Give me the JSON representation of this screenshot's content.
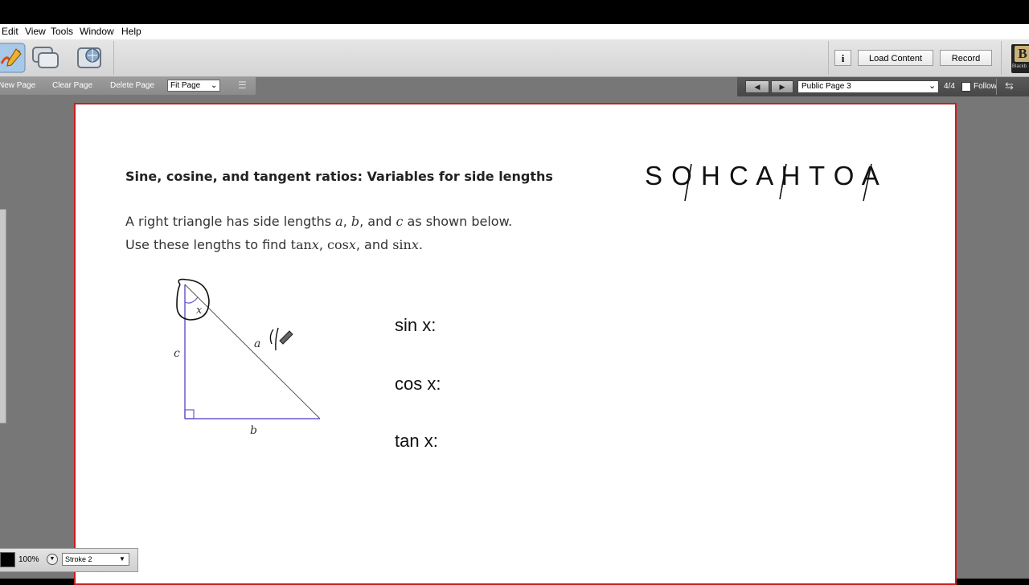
{
  "menu": [
    "Edit",
    "View",
    "Tools",
    "Window",
    "Help"
  ],
  "toolbar": {
    "info_label": "i",
    "load_content_label": "Load Content",
    "record_label": "Record",
    "brand_letter": "B",
    "brand_text": "Blackb"
  },
  "page_toolbar": {
    "new_page": "New Page",
    "clear_page": "Clear Page",
    "delete_page": "Delete Page",
    "fit_value": "Fit Page"
  },
  "nav": {
    "page_select": "Public Page 3",
    "page_count": "4/4",
    "follow_label": "Follow"
  },
  "content": {
    "title": "Sine, cosine, and tangent ratios: Variables for side lengths",
    "line1_a": "A right triangle has side lengths ",
    "line1_v1": "a",
    "line1_sep1": ", ",
    "line1_v2": "b",
    "line1_sep2": ", and ",
    "line1_v3": "c",
    "line1_b": " as shown below.",
    "line2_a": "Use these lengths to find ",
    "line2_tan": "tan",
    "line2_x1": "x",
    "line2_sep1": ", ",
    "line2_cos": "cos",
    "line2_x2": "x",
    "line2_sep2": ", and ",
    "line2_sin": "sin",
    "line2_x3": "x",
    "line2_end": ".",
    "triangle_labels": {
      "angle": "x",
      "hyp": "a",
      "vert": "c",
      "horiz": "b"
    },
    "mnemonic": "S O H   C A H   T O A",
    "sin_label": "sin x:",
    "cos_label": "cos x:",
    "tan_label": "tan x:"
  },
  "bottom": {
    "zoom": "100%",
    "stroke": "Stroke 2"
  }
}
